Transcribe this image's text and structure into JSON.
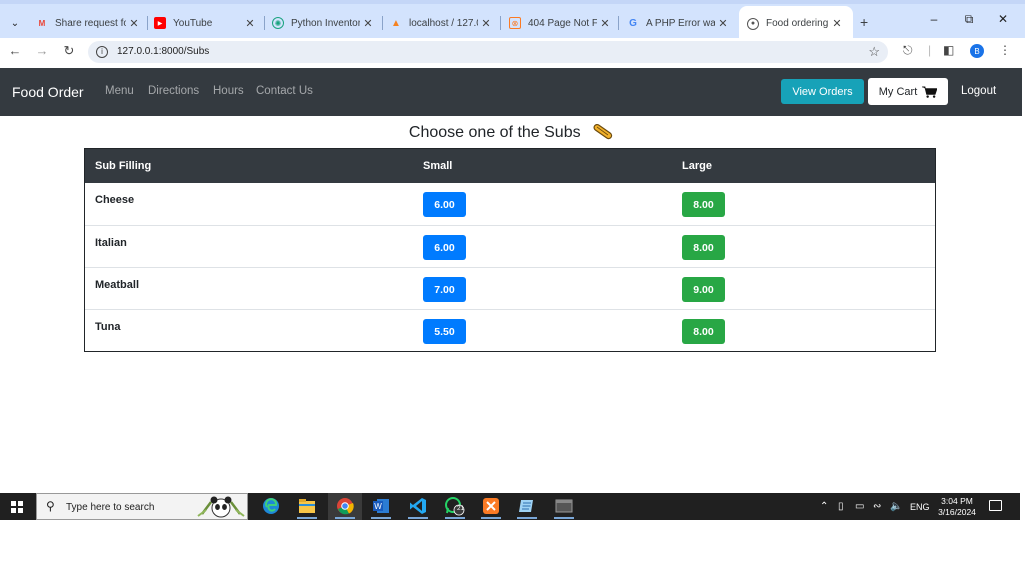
{
  "browser": {
    "tabs": [
      {
        "title": "Share request fo",
        "favicon": "gmail-icon",
        "active": false
      },
      {
        "title": "YouTube",
        "favicon": "youtube-icon",
        "active": false
      },
      {
        "title": "Python Inventor",
        "favicon": "chatgpt-icon",
        "active": false
      },
      {
        "title": "localhost / 127.0",
        "favicon": "phpmyadmin-icon",
        "active": false
      },
      {
        "title": "404 Page Not Fo",
        "favicon": "xampp-icon",
        "active": false
      },
      {
        "title": "A PHP Error was",
        "favicon": "google-icon",
        "active": false
      },
      {
        "title": "Food ordering",
        "favicon": "globe-icon",
        "active": true
      }
    ],
    "url": "127.0.0.1:8000/Subs",
    "profile_initial": "B"
  },
  "app": {
    "brand": "Food Order",
    "nav_links": [
      "Menu",
      "Directions",
      "Hours",
      "Contact Us"
    ],
    "view_orders_label": "View Orders",
    "cart_label": "My Cart",
    "logout_label": "Logout",
    "colors": {
      "navbar": "#343a40",
      "view_orders": "#17a2b8",
      "small_price": "#007bff",
      "large_price": "#28a745"
    }
  },
  "page": {
    "heading": "Choose one of the Subs",
    "table": {
      "headers": [
        "Sub Filling",
        "Small",
        "Large"
      ],
      "rows": [
        {
          "name": "Cheese",
          "small": "6.00",
          "large": "8.00"
        },
        {
          "name": "Italian",
          "small": "6.00",
          "large": "8.00"
        },
        {
          "name": "Meatball",
          "small": "7.00",
          "large": "9.00"
        },
        {
          "name": "Tuna",
          "small": "5.50",
          "large": "8.00"
        }
      ]
    }
  },
  "taskbar": {
    "search_placeholder": "Type here to search",
    "whatsapp_badge": "21",
    "language": "ENG",
    "time": "3:04 PM",
    "date": "3/16/2024"
  }
}
